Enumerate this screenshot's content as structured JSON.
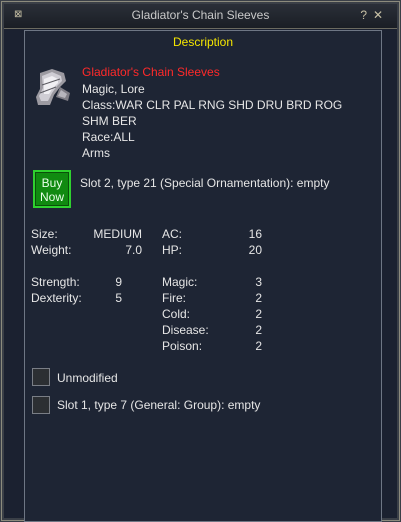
{
  "window": {
    "title": "Gladiator's Chain Sleeves",
    "minimize_icon": "⊠",
    "help_icon": "?",
    "close_icon": "✕"
  },
  "description": {
    "header": "Description",
    "item_name": "Gladiator's Chain Sleeves",
    "flags": "Magic, Lore",
    "class_line1": "Class:WAR CLR PAL RNG SHD DRU BRD ROG",
    "class_line2": "SHM BER",
    "race": "Race:ALL",
    "slot": "Arms",
    "buy_button": "Buy Now",
    "aug_slot_text": "Slot 2, type 21 (Special Ornamentation): empty",
    "stats_left": [
      {
        "label": "Size:",
        "value": "MEDIUM"
      },
      {
        "label": "Weight:",
        "value": "7.0"
      }
    ],
    "stats_right": [
      {
        "label": "AC:",
        "value": "16"
      },
      {
        "label": "HP:",
        "value": "20"
      }
    ],
    "attributes": [
      {
        "label": "Strength:",
        "value": "9"
      },
      {
        "label": "Dexterity:",
        "value": "5"
      }
    ],
    "resists": [
      {
        "label": "Magic:",
        "value": "3"
      },
      {
        "label": "Fire:",
        "value": "2"
      },
      {
        "label": "Cold:",
        "value": "2"
      },
      {
        "label": "Disease:",
        "value": "2"
      },
      {
        "label": "Poison:",
        "value": "2"
      }
    ],
    "unmodified_label": "Unmodified",
    "aug_slot1_text": "Slot 1, type 7 (General: Group): empty"
  }
}
